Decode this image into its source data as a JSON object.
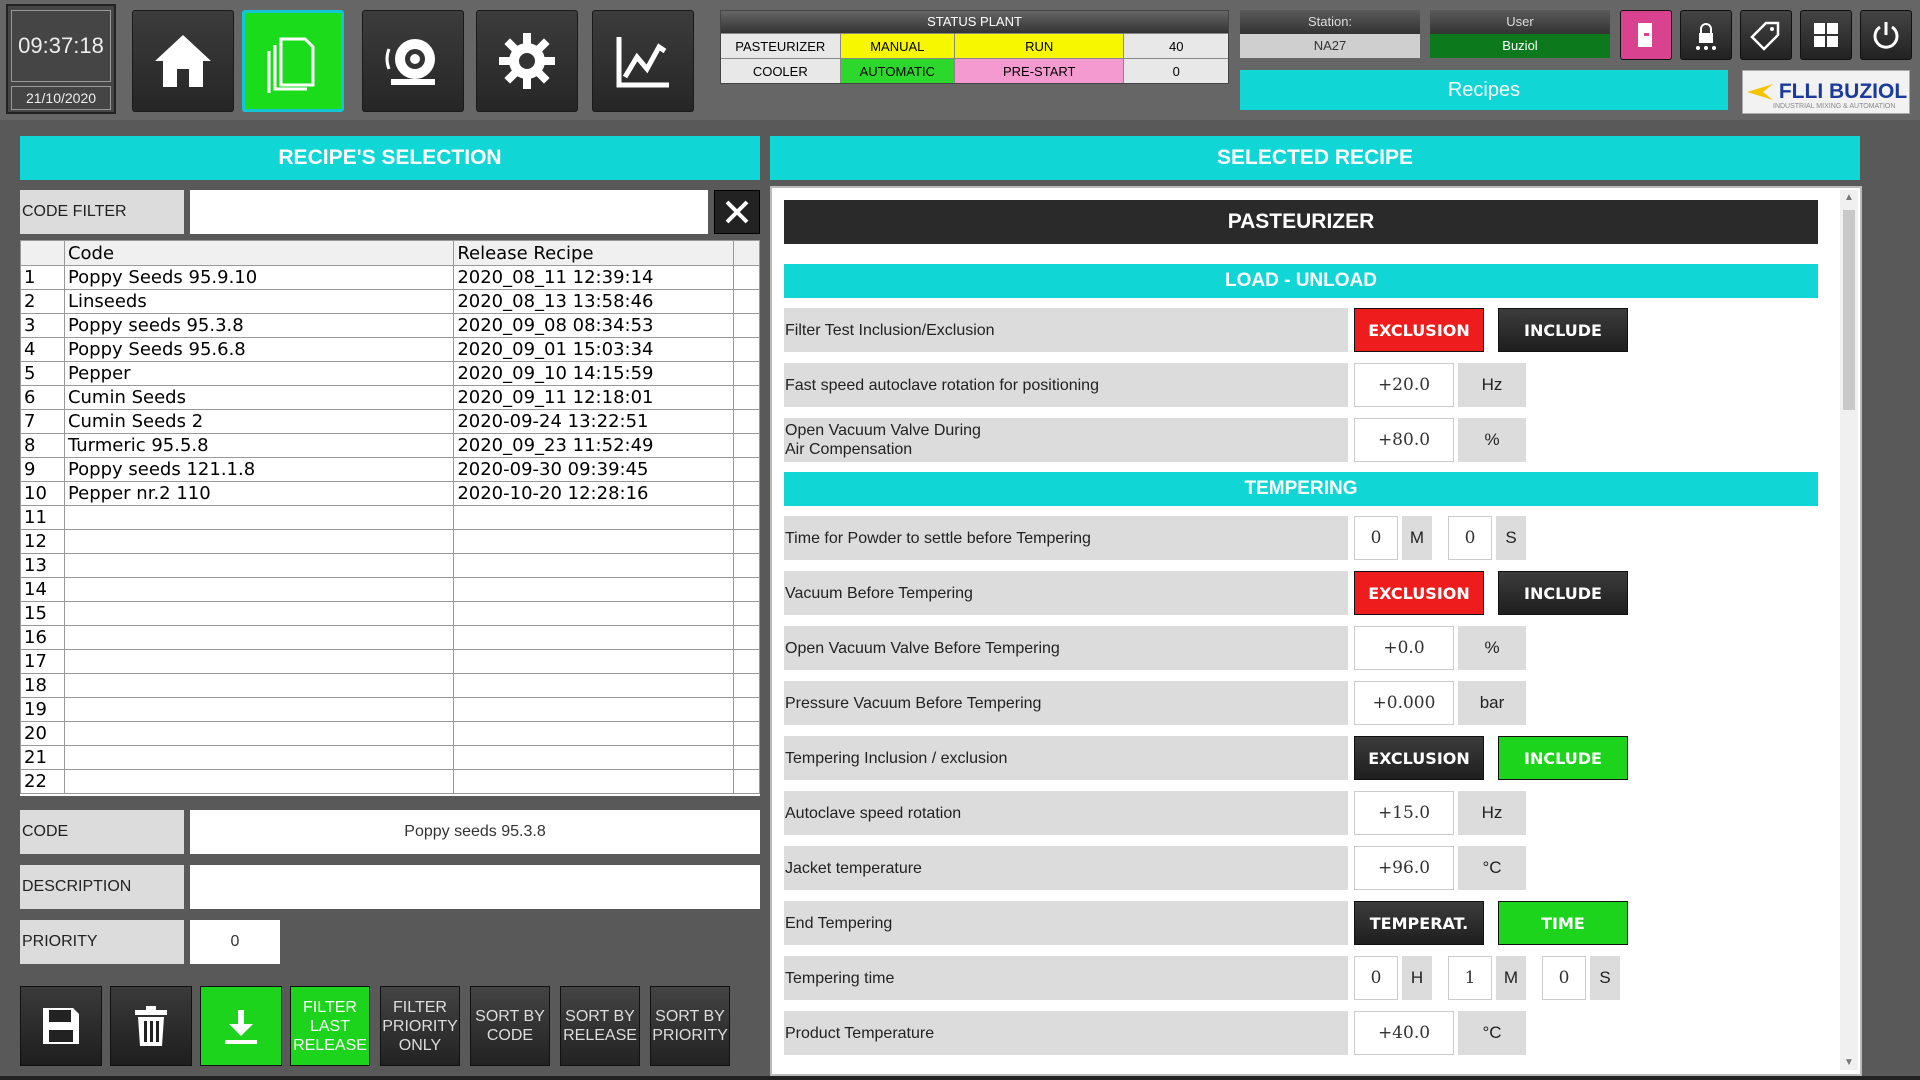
{
  "clock": {
    "time": "09:37:18",
    "date": "21/10/2020"
  },
  "status_plant": {
    "title": "STATUS PLANT",
    "rows": [
      {
        "name": "PASTEURIZER",
        "mode": "MANUAL",
        "mode_color": "#f7f700",
        "state": "RUN",
        "state_color": "#f7f700",
        "value": "40"
      },
      {
        "name": "COOLER",
        "mode": "AUTOMATIC",
        "mode_color": "#2cd82c",
        "state": "PRE-START",
        "state_color": "#f59ad0",
        "value": "0"
      }
    ]
  },
  "station": {
    "label": "Station:",
    "value": "NA27",
    "value_color": "#cfcfcf"
  },
  "user": {
    "label": "User",
    "value": "Buziol",
    "value_color": "#0c7a1c"
  },
  "page_banner": "Recipes",
  "logo": {
    "text": "FLLI BUZIOL",
    "sub": "INDUSTRIAL MIXING & AUTOMATION"
  },
  "left": {
    "title": "RECIPE'S SELECTION",
    "code_filter_label": "CODE FILTER",
    "code_filter_value": "",
    "table": {
      "headers": [
        "",
        "Code",
        "Release Recipe"
      ],
      "rows": [
        [
          "1",
          "Poppy Seeds 95.9.10",
          "2020_08_11 12:39:14"
        ],
        [
          "2",
          "Linseeds",
          "2020_08_13 13:58:46"
        ],
        [
          "3",
          "Poppy seeds 95.3.8",
          "2020_09_08 08:34:53"
        ],
        [
          "4",
          "Poppy Seeds 95.6.8",
          "2020_09_01 15:03:34"
        ],
        [
          "5",
          "Pepper",
          "2020_09_10 14:15:59"
        ],
        [
          "6",
          "Cumin Seeds",
          "2020_09_11 12:18:01"
        ],
        [
          "7",
          "Cumin Seeds 2",
          "2020-09-24 13:22:51"
        ],
        [
          "8",
          "Turmeric 95.5.8",
          "2020_09_23 11:52:49"
        ],
        [
          "9",
          "Poppy seeds 121.1.8",
          "2020-09-30 09:39:45"
        ],
        [
          "10",
          "Pepper nr.2 110",
          "2020-10-20 12:28:16"
        ],
        [
          "11",
          "",
          ""
        ],
        [
          "12",
          "",
          ""
        ],
        [
          "13",
          "",
          ""
        ],
        [
          "14",
          "",
          ""
        ],
        [
          "15",
          "",
          ""
        ],
        [
          "16",
          "",
          ""
        ],
        [
          "17",
          "",
          ""
        ],
        [
          "18",
          "",
          ""
        ],
        [
          "19",
          "",
          ""
        ],
        [
          "20",
          "",
          ""
        ],
        [
          "21",
          "",
          ""
        ],
        [
          "22",
          "",
          ""
        ]
      ]
    },
    "code_label": "CODE",
    "code_value": "Poppy seeds 95.3.8",
    "description_label": "DESCRIPTION",
    "description_value": "",
    "priority_label": "PRIORITY",
    "priority_value": "0",
    "buttons": {
      "filter_last_release": "FILTER LAST RELEASE",
      "filter_priority_only": "FILTER PRIORITY ONLY",
      "sort_by_code": "SORT BY CODE",
      "sort_by_release": "SORT BY RELEASE",
      "sort_by_priority": "SORT BY PRIORITY"
    }
  },
  "right": {
    "title": "SELECTED RECIPE",
    "section": "PASTEURIZER",
    "load_unload": "LOAD - UNLOAD",
    "tempering": "TEMPERING",
    "params": {
      "filter_test": {
        "label": "Filter Test Inclusion/Exclusion",
        "opt_a": "EXCLUSION",
        "opt_b": "INCLUDE"
      },
      "fast_speed": {
        "label": "Fast speed autoclave rotation for positioning",
        "value": "+20.0",
        "unit": "Hz"
      },
      "open_vacuum_air": {
        "label_1": "Open Vacuum Valve During",
        "label_2": "Air Compensation",
        "value": "+80.0",
        "unit": "%"
      },
      "powder_settle": {
        "label": "Time for Powder to settle before Tempering",
        "minutes": "0",
        "m_unit": "M",
        "seconds": "0",
        "s_unit": "S"
      },
      "vacuum_before": {
        "label": "Vacuum Before Tempering",
        "opt_a": "EXCLUSION",
        "opt_b": "INCLUDE"
      },
      "open_vacuum_before": {
        "label": "Open Vacuum Valve Before Tempering",
        "value": "+0.0",
        "unit": "%"
      },
      "pressure_vacuum": {
        "label": "Pressure Vacuum Before Tempering",
        "value": "+0.000",
        "unit": "bar"
      },
      "tempering_incl": {
        "label": "Tempering  Inclusion / exclusion",
        "opt_a": "EXCLUSION",
        "opt_b": "INCLUDE"
      },
      "autoclave_speed": {
        "label": "Autoclave speed rotation",
        "value": "+15.0",
        "unit": "Hz"
      },
      "jacket_temp": {
        "label": "Jacket temperature",
        "value": "+96.0",
        "unit": "°C"
      },
      "end_tempering": {
        "label": "End Tempering",
        "opt_a": "TEMPERAT.",
        "opt_b": "TIME"
      },
      "tempering_time": {
        "label": "Tempering time",
        "hours": "0",
        "h_unit": "H",
        "minutes": "1",
        "m_unit": "M",
        "seconds": "0",
        "s_unit": "S"
      },
      "product_temp": {
        "label": "Product Temperature",
        "value": "+40.0",
        "unit": "°C"
      }
    }
  },
  "colors": {
    "accent": "#10d6d6",
    "active_green": "#1bd41b",
    "alert_red": "#ee1c1c",
    "background": "#595959"
  }
}
